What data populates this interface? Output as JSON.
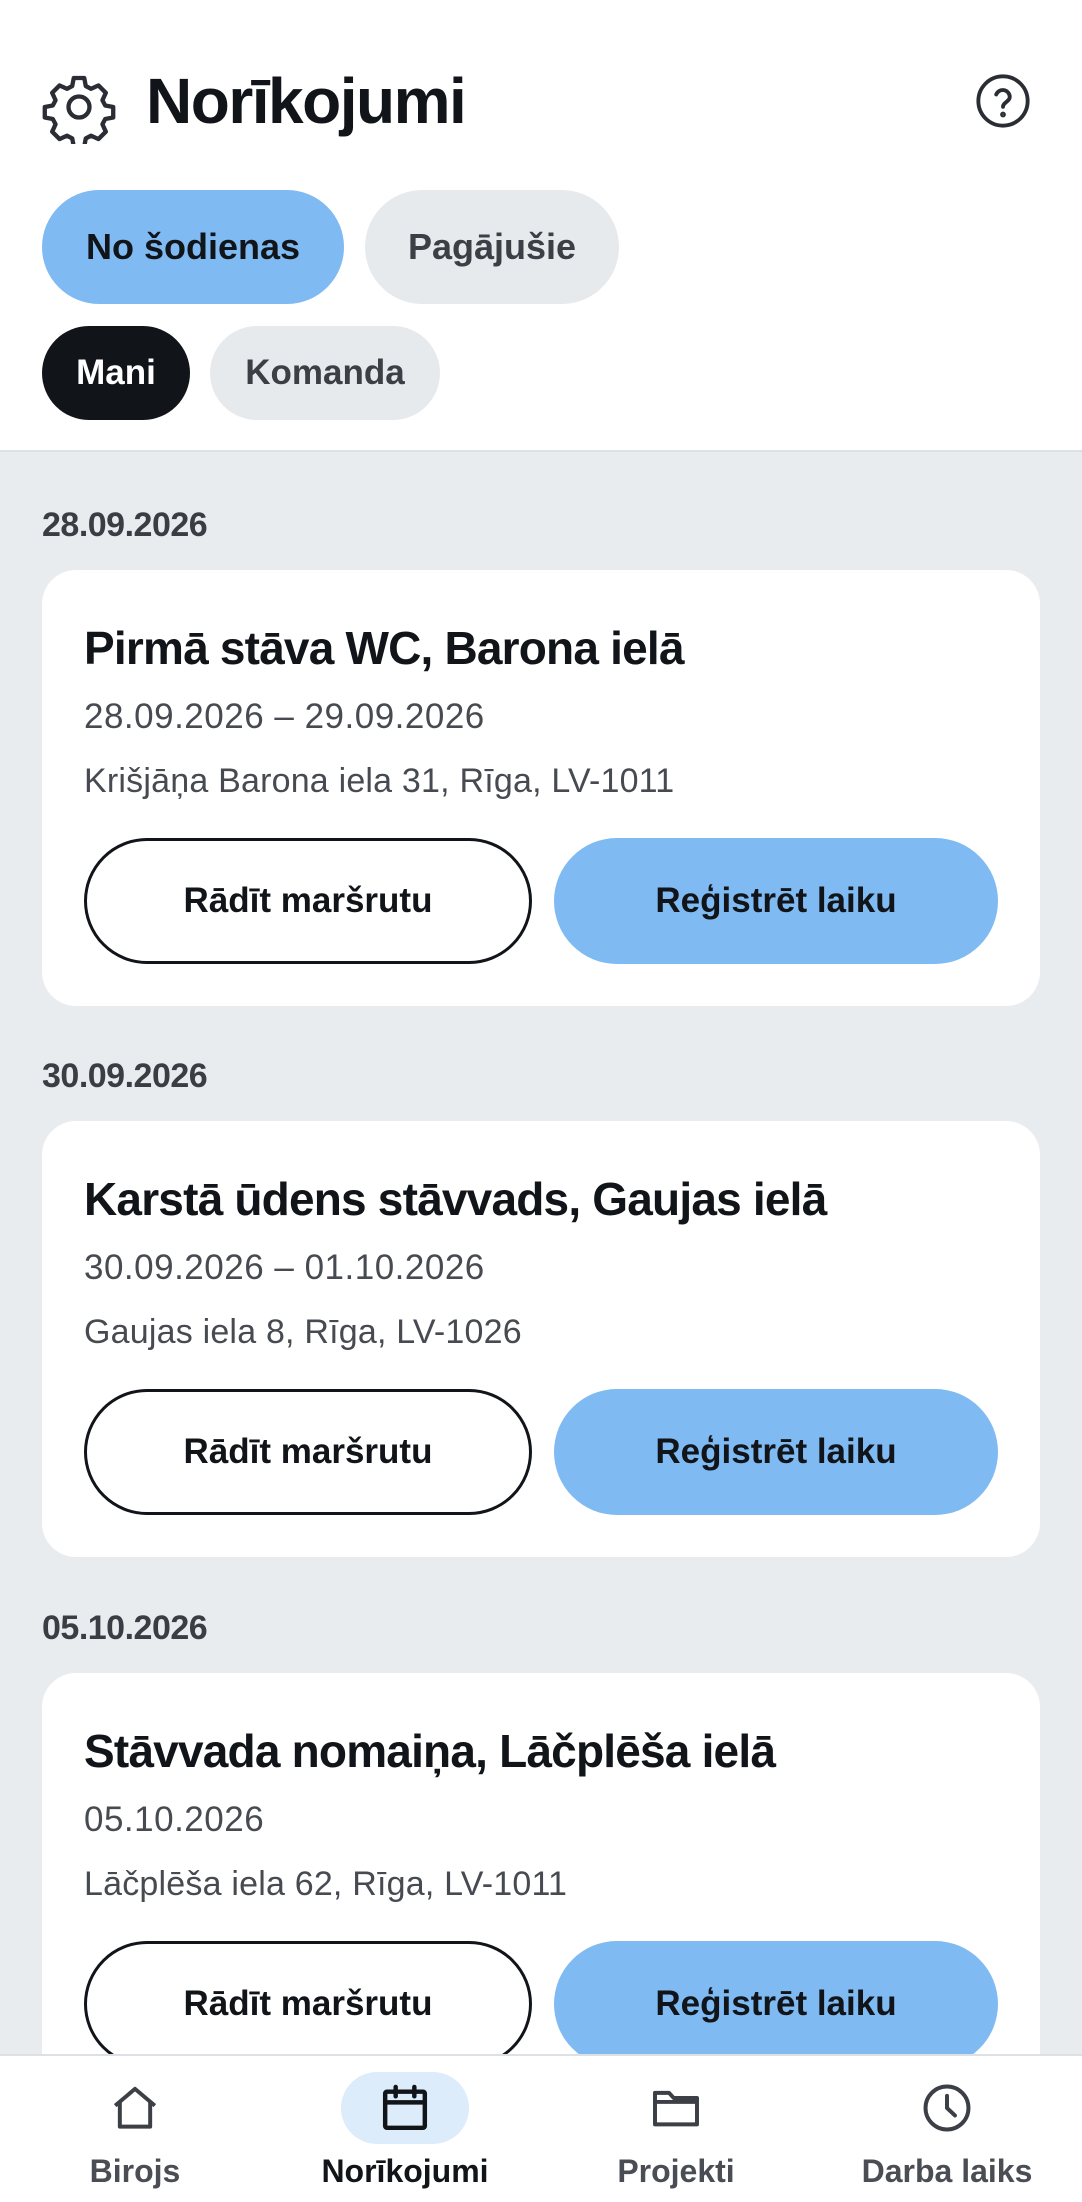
{
  "header": {
    "title": "Norīkojumi",
    "settings_icon": "gear-icon",
    "help_icon": "help-icon"
  },
  "filters": {
    "period": [
      {
        "label": "No šodienas",
        "selected": true
      },
      {
        "label": "Pagājušie",
        "selected": false
      }
    ],
    "scope": [
      {
        "label": "Mani",
        "selected": true
      },
      {
        "label": "Komanda",
        "selected": false
      }
    ]
  },
  "assignments": [
    {
      "date_header": "28.09.2026",
      "title": "Pirmā stāva WC, Barona ielā",
      "dates": "28.09.2026 – 29.09.2026",
      "address": "Krišjāņa Barona iela 31, Rīga, LV-1011",
      "route_label": "Rādīt maršrutu",
      "register_label": "Reģistrēt laiku"
    },
    {
      "date_header": "30.09.2026",
      "title": "Karstā ūdens stāvvads, Gaujas ielā",
      "dates": "30.09.2026 – 01.10.2026",
      "address": "Gaujas iela 8, Rīga, LV-1026",
      "route_label": "Rādīt maršrutu",
      "register_label": "Reģistrēt laiku"
    },
    {
      "date_header": "05.10.2026",
      "title": "Stāvvada nomaiņa, Lāčplēša ielā",
      "dates": "05.10.2026",
      "address": "Lāčplēša iela 62, Rīga, LV-1011",
      "route_label": "Rādīt maršrutu",
      "register_label": "Reģistrēt laiku"
    }
  ],
  "bottom_nav": [
    {
      "label": "Birojs",
      "icon": "home-icon",
      "active": false
    },
    {
      "label": "Norīkojumi",
      "icon": "calendar-icon",
      "active": true
    },
    {
      "label": "Projekti",
      "icon": "folder-icon",
      "active": false
    },
    {
      "label": "Darba laiks",
      "icon": "clock-icon",
      "active": false
    }
  ],
  "colors": {
    "accent": "#7fbaf2",
    "selected_chip_dark": "#111418",
    "list_background": "#e9ecef",
    "nav_active_pill": "#dcecfb"
  }
}
